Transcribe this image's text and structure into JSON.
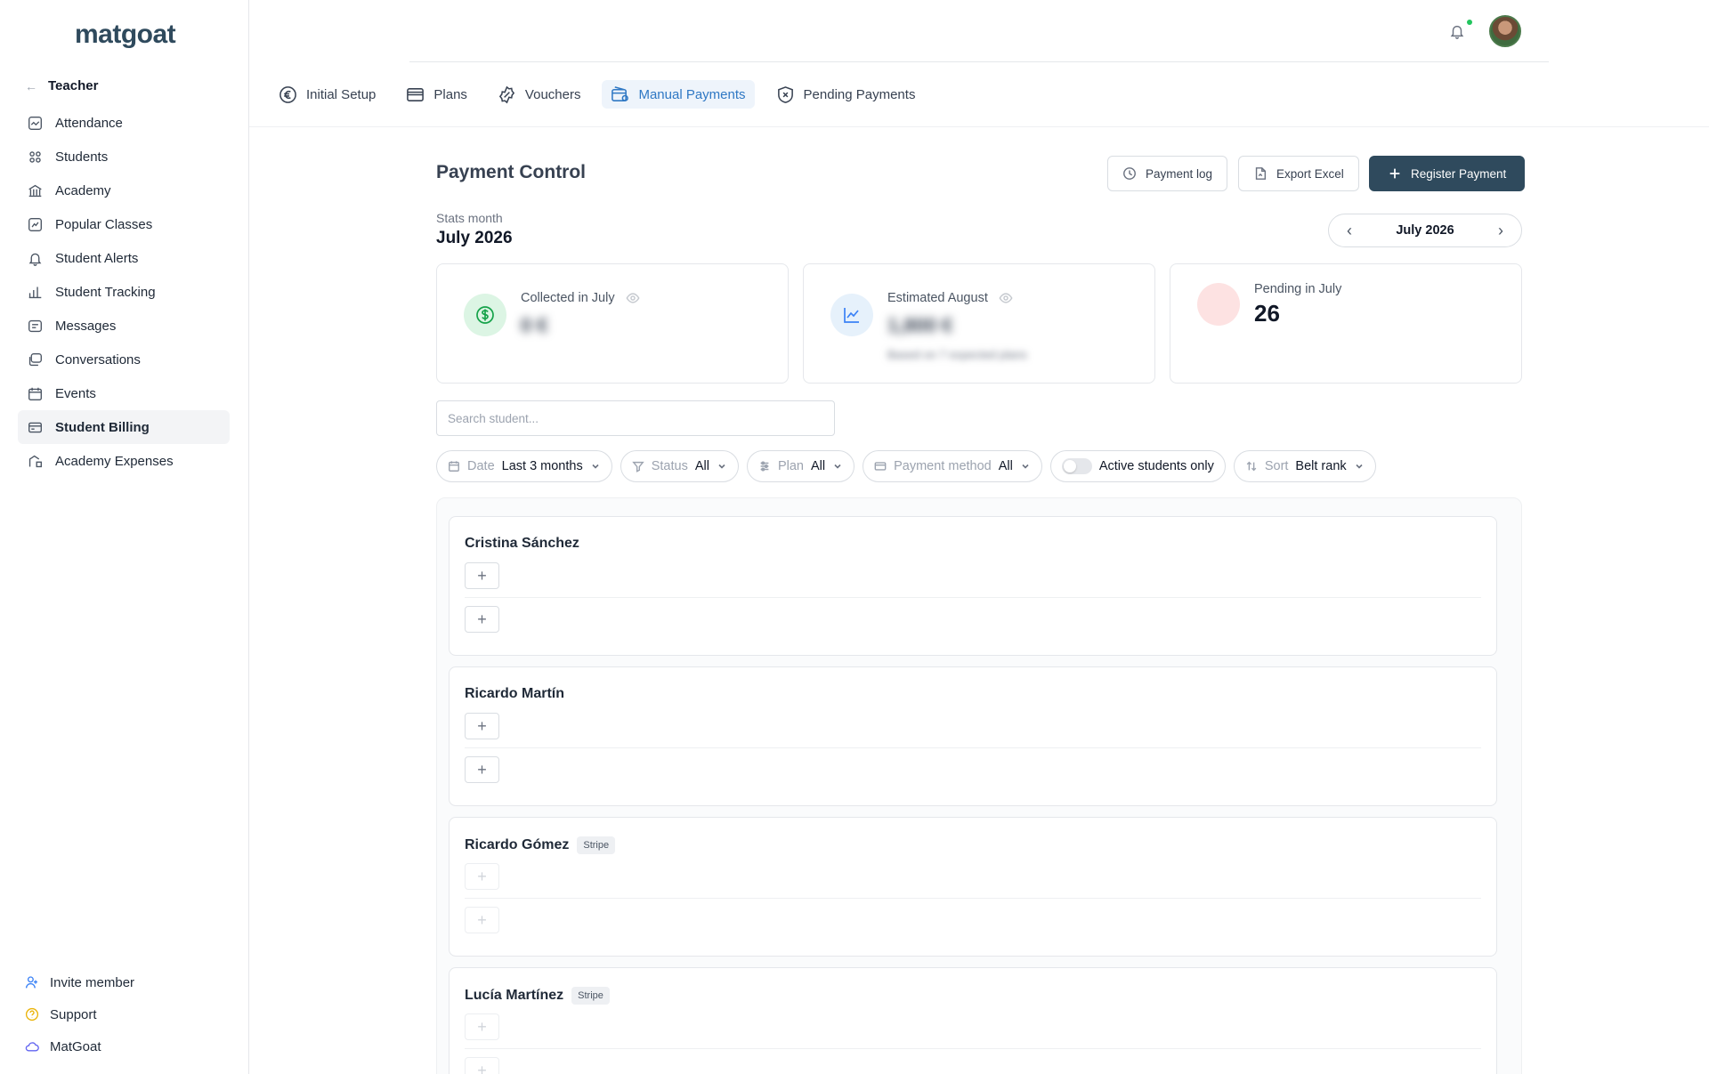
{
  "sidebar": {
    "logo": "matgoat",
    "back_label": "Teacher",
    "items": [
      {
        "label": "Attendance",
        "icon": "attendance-icon"
      },
      {
        "label": "Students",
        "icon": "students-icon"
      },
      {
        "label": "Academy",
        "icon": "academy-icon"
      },
      {
        "label": "Popular Classes",
        "icon": "popular-classes-icon"
      },
      {
        "label": "Student Alerts",
        "icon": "bell-icon"
      },
      {
        "label": "Student Tracking",
        "icon": "bar-chart-icon"
      },
      {
        "label": "Messages",
        "icon": "message-icon"
      },
      {
        "label": "Conversations",
        "icon": "conversations-icon"
      },
      {
        "label": "Events",
        "icon": "calendar-icon"
      },
      {
        "label": "Student Billing",
        "icon": "billing-icon",
        "active": true
      },
      {
        "label": "Academy Expenses",
        "icon": "expenses-icon"
      }
    ],
    "bottom": [
      {
        "label": "Invite member",
        "icon": "user-plus-icon",
        "color": "#3b82f6"
      },
      {
        "label": "Support",
        "icon": "help-icon",
        "color": "#eab308"
      },
      {
        "label": "MatGoat",
        "icon": "cloud-icon",
        "color": "#6366f1"
      }
    ]
  },
  "tabs": [
    {
      "label": "Initial Setup",
      "icon": "euro-icon"
    },
    {
      "label": "Plans",
      "icon": "card-icon"
    },
    {
      "label": "Vouchers",
      "icon": "voucher-icon"
    },
    {
      "label": "Manual Payments",
      "icon": "wallet-icon",
      "active": true
    },
    {
      "label": "Pending Payments",
      "icon": "shield-x-icon"
    }
  ],
  "main": {
    "title": "Payment Control",
    "buttons": {
      "payment_log": "Payment log",
      "export_excel": "Export Excel",
      "register_payment": "Register Payment"
    },
    "stats_label": "Stats month",
    "stats_month": "July 2026",
    "month_picker": "July 2026",
    "cards": [
      {
        "label": "Collected in July",
        "value": "0 €"
      },
      {
        "label": "Estimated August",
        "value": "1,800 €",
        "sub": "Based on 7 expected plans"
      },
      {
        "label": "Pending in July",
        "value": "26"
      }
    ],
    "search_placeholder": "Search student...",
    "filters": {
      "date_label": "Date",
      "date_value": "Last 3 months",
      "status_label": "Status",
      "status_value": "All",
      "plan_label": "Plan",
      "plan_value": "All",
      "method_label": "Payment method",
      "method_value": "All",
      "active_only": "Active students only",
      "sort_label": "Sort",
      "sort_value": "Belt rank"
    },
    "students": [
      {
        "name": "Cristina Sánchez",
        "badge": ""
      },
      {
        "name": "Ricardo Martín",
        "badge": ""
      },
      {
        "name": "Ricardo Gómez",
        "badge": "Stripe"
      },
      {
        "name": "Lucía Martínez",
        "badge": "Stripe"
      }
    ]
  },
  "colors": {
    "primary": "#2f4a5d",
    "tab_active": "#2f78c4",
    "success": "#22c55e",
    "pending": "#fde2e2"
  }
}
